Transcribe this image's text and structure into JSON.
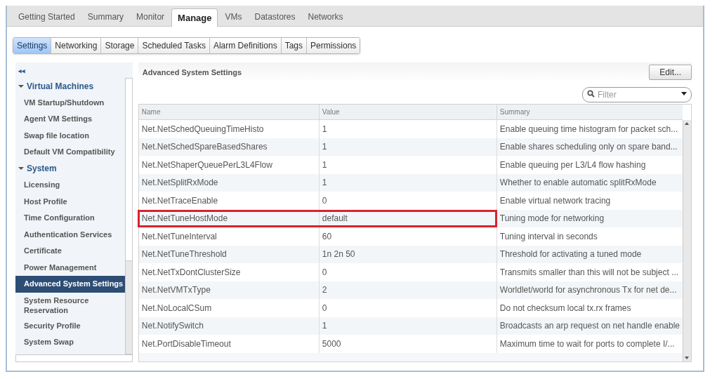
{
  "top_tabs": [
    {
      "label": "Getting Started",
      "selected": false
    },
    {
      "label": "Summary",
      "selected": false
    },
    {
      "label": "Monitor",
      "selected": false
    },
    {
      "label": "Manage",
      "selected": true
    },
    {
      "label": "VMs",
      "selected": false
    },
    {
      "label": "Datastores",
      "selected": false
    },
    {
      "label": "Networks",
      "selected": false
    }
  ],
  "sub_tabs": [
    {
      "label": "Settings",
      "selected": true
    },
    {
      "label": "Networking",
      "selected": false
    },
    {
      "label": "Storage",
      "selected": false
    },
    {
      "label": "Scheduled Tasks",
      "selected": false
    },
    {
      "label": "Alarm Definitions",
      "selected": false
    },
    {
      "label": "Tags",
      "selected": false
    },
    {
      "label": "Permissions",
      "selected": false
    }
  ],
  "sidebar": {
    "collapse_glyph": "◂◂",
    "items": [
      {
        "kind": "group",
        "label": "Virtual Machines",
        "expanded": true,
        "children": [
          {
            "label": "VM Startup/Shutdown",
            "selected": false
          },
          {
            "label": "Agent VM Settings",
            "selected": false
          },
          {
            "label": "Swap file location",
            "selected": false
          },
          {
            "label": "Default VM Compatibility",
            "selected": false
          }
        ]
      },
      {
        "kind": "group",
        "label": "System",
        "expanded": true,
        "children": [
          {
            "label": "Licensing",
            "selected": false
          },
          {
            "label": "Host Profile",
            "selected": false
          },
          {
            "label": "Time Configuration",
            "selected": false
          },
          {
            "label": "Authentication Services",
            "selected": false
          },
          {
            "label": "Certificate",
            "selected": false
          },
          {
            "label": "Power Management",
            "selected": false
          },
          {
            "label": "Advanced System Settings",
            "selected": true
          },
          {
            "label": "System Resource Reservation",
            "selected": false
          },
          {
            "label": "Security Profile",
            "selected": false
          },
          {
            "label": "System Swap",
            "selected": false
          }
        ]
      }
    ]
  },
  "panel": {
    "title": "Advanced System Settings",
    "edit_button": "Edit...",
    "filter": {
      "placeholder": "Filter"
    }
  },
  "table": {
    "columns": [
      "Name",
      "Value",
      "Summary"
    ],
    "rows": [
      {
        "name": "Net.NetSchedQueuingTimeHisto",
        "value": "1",
        "summary": "Enable queuing time histogram for packet sch...",
        "highlighted": false
      },
      {
        "name": "Net.NetSchedSpareBasedShares",
        "value": "1",
        "summary": "Enable shares scheduling only on spare band...",
        "highlighted": false
      },
      {
        "name": "Net.NetShaperQueuePerL3L4Flow",
        "value": "1",
        "summary": "Enable queuing per L3/L4 flow hashing",
        "highlighted": false
      },
      {
        "name": "Net.NetSplitRxMode",
        "value": "1",
        "summary": "Whether to enable automatic splitRxMode",
        "highlighted": false
      },
      {
        "name": "Net.NetTraceEnable",
        "value": "0",
        "summary": "Enable virtual network tracing",
        "highlighted": false
      },
      {
        "name": "Net.NetTuneHostMode",
        "value": "default",
        "summary": "Tuning mode for networking",
        "highlighted": true
      },
      {
        "name": "Net.NetTuneInterval",
        "value": "60",
        "summary": "Tuning interval in seconds",
        "highlighted": false
      },
      {
        "name": "Net.NetTuneThreshold",
        "value": "1n 2n 50",
        "summary": "Threshold for activating a tuned mode",
        "highlighted": false
      },
      {
        "name": "Net.NetTxDontClusterSize",
        "value": "0",
        "summary": "Transmits smaller than this will not be subject ...",
        "highlighted": false
      },
      {
        "name": "Net.NetVMTxType",
        "value": "2",
        "summary": "Worldlet/world for asynchronous Tx for net de...",
        "highlighted": false
      },
      {
        "name": "Net.NoLocalCSum",
        "value": "0",
        "summary": "Do not checksum local tx.rx frames",
        "highlighted": false
      },
      {
        "name": "Net.NotifySwitch",
        "value": "1",
        "summary": "Broadcasts an arp request on net handle enable",
        "highlighted": false
      },
      {
        "name": "Net.PortDisableTimeout",
        "value": "5000",
        "summary": "Maximum time to wait for ports to complete I/...",
        "highlighted": false
      }
    ]
  }
}
